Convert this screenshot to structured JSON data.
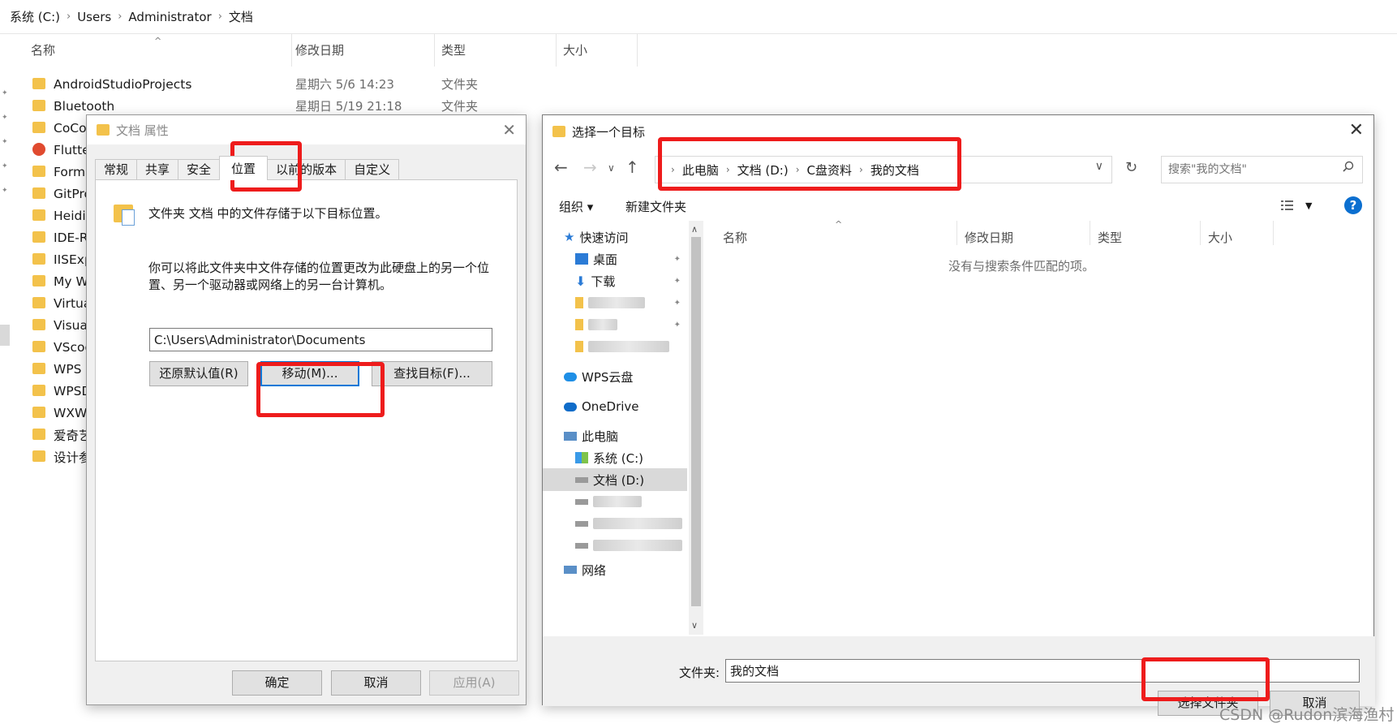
{
  "explorer": {
    "breadcrumb": [
      "系统 (C:)",
      "Users",
      "Administrator",
      "文档"
    ],
    "columns": [
      "名称",
      "修改日期",
      "类型",
      "大小"
    ],
    "files": [
      {
        "name": "AndroidStudioProjects",
        "date": "星期六 5/6 14:23",
        "type": "文件夹",
        "icon": "folder-icon"
      },
      {
        "name": "Bluetooth",
        "date": "星期日 5/19 21:18",
        "type": "文件夹",
        "icon": "folder-icon"
      },
      {
        "name": "CoCo",
        "date": "",
        "type": "",
        "icon": "folder-icon"
      },
      {
        "name": "Flutte",
        "date": "",
        "type": "",
        "icon": "flutter-app-icon"
      },
      {
        "name": "Forma",
        "date": "",
        "type": "",
        "icon": "folder-icon"
      },
      {
        "name": "GitPro",
        "date": "",
        "type": "",
        "icon": "folder-icon"
      },
      {
        "name": "Heidi",
        "date": "",
        "type": "",
        "icon": "folder-icon"
      },
      {
        "name": "IDE-R",
        "date": "",
        "type": "",
        "icon": "folder-icon"
      },
      {
        "name": "IISExp",
        "date": "",
        "type": "",
        "icon": "folder-icon"
      },
      {
        "name": "My W",
        "date": "",
        "type": "",
        "icon": "folder-icon"
      },
      {
        "name": "Virtua",
        "date": "",
        "type": "",
        "icon": "folder-icon"
      },
      {
        "name": "Visual",
        "date": "",
        "type": "",
        "icon": "folder-icon"
      },
      {
        "name": "VScod",
        "date": "",
        "type": "",
        "icon": "folder-icon"
      },
      {
        "name": "WPS (",
        "date": "",
        "type": "",
        "icon": "folder-icon"
      },
      {
        "name": "WPSD",
        "date": "",
        "type": "",
        "icon": "folder-icon"
      },
      {
        "name": "WXW",
        "date": "",
        "type": "",
        "icon": "folder-icon"
      },
      {
        "name": "爱奇艺",
        "date": "",
        "type": "",
        "icon": "folder-icon"
      },
      {
        "name": "设计参",
        "date": "",
        "type": "",
        "icon": "folder-icon"
      }
    ]
  },
  "props_dialog": {
    "title": "文档 属性",
    "tabs": [
      "常规",
      "共享",
      "安全",
      "位置",
      "以前的版本",
      "自定义"
    ],
    "active_tab": "位置",
    "header": "文件夹 文档 中的文件存储于以下目标位置。",
    "description": "你可以将此文件夹中文件存储的位置更改为此硬盘上的另一个位置、另一个驱动器或网络上的另一台计算机。",
    "path_value": "C:\\Users\\Administrator\\Documents",
    "buttons": {
      "restore": "还原默认值(R)",
      "move": "移动(M)...",
      "find": "查找目标(F)...",
      "ok": "确定",
      "cancel": "取消",
      "apply": "应用(A)"
    }
  },
  "picker_dialog": {
    "title": "选择一个目标",
    "breadcrumb": [
      "此电脑",
      "文档 (D:)",
      "C盘资料",
      "我的文档"
    ],
    "search_placeholder": "搜索\"我的文档\"",
    "toolbar": {
      "organize": "组织 ▾",
      "new_folder": "新建文件夹"
    },
    "columns": [
      "名称",
      "修改日期",
      "类型",
      "大小"
    ],
    "empty_message": "没有与搜索条件匹配的项。",
    "tree": {
      "quick_access": "快速访问",
      "desktop": "桌面",
      "downloads": "下载",
      "wps_cloud": "WPS云盘",
      "onedrive": "OneDrive",
      "this_pc": "此电脑",
      "drive_c": "系统 (C:)",
      "drive_d": "文档 (D:)",
      "network": "网络"
    },
    "folder_label": "文件夹:",
    "folder_value": "我的文档",
    "buttons": {
      "select": "选择文件夹",
      "cancel": "取消"
    }
  },
  "watermark": "CSDN @Rudon滨海渔村",
  "colors": {
    "highlight": "#ee1c1c",
    "accent": "#0078d7",
    "folder": "#f3c24b"
  }
}
